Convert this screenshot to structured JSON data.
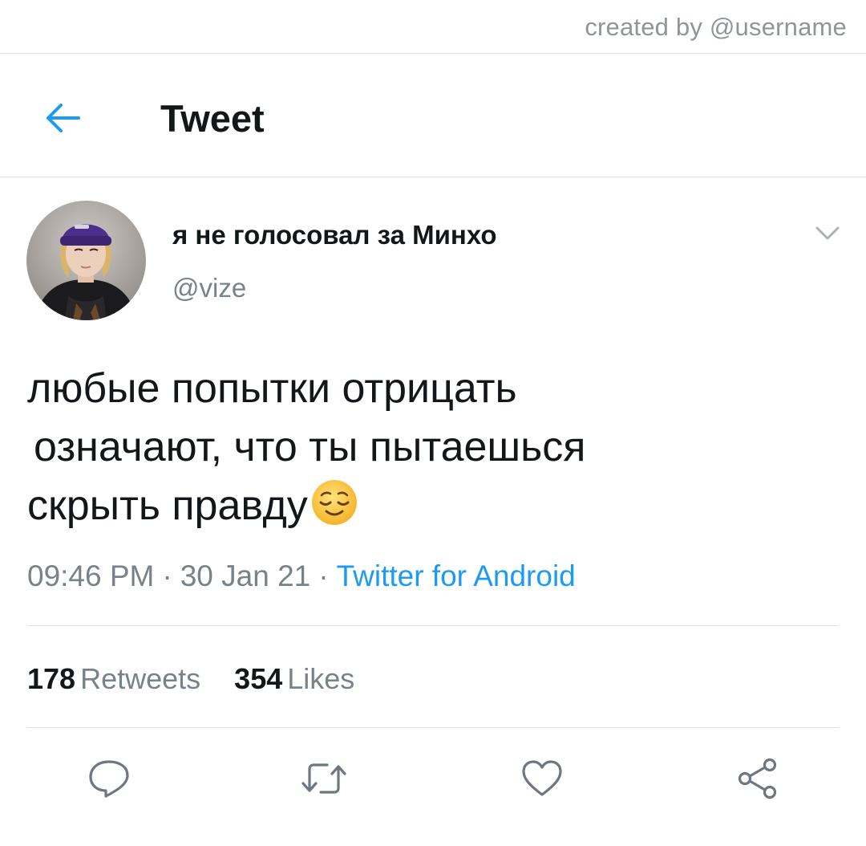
{
  "watermark": "created by @username",
  "header": {
    "title": "Tweet",
    "back_icon": "arrow-left-icon"
  },
  "tweet": {
    "display_name": "я не голосовал за Минхо",
    "handle": "@vize",
    "text_lines": [
      "любые попытки отрицать",
      " означают, что ты пытаешься",
      "скрыть правду"
    ],
    "emoji": "relieved-face-emoji",
    "time": "09:46 PM",
    "date": "30 Jan 21",
    "separator": "·",
    "source": "Twitter for Android"
  },
  "stats": {
    "retweets_count": "178",
    "retweets_label": "Retweets",
    "likes_count": "354",
    "likes_label": "Likes"
  },
  "actions": [
    {
      "icon": "reply-icon"
    },
    {
      "icon": "retweet-icon"
    },
    {
      "icon": "like-heart-icon"
    },
    {
      "icon": "share-icon"
    }
  ],
  "colors": {
    "link": "#1d9bf0",
    "secondary_text": "#7a8289",
    "primary_text": "#14171a",
    "divider": "#dde1e5"
  }
}
